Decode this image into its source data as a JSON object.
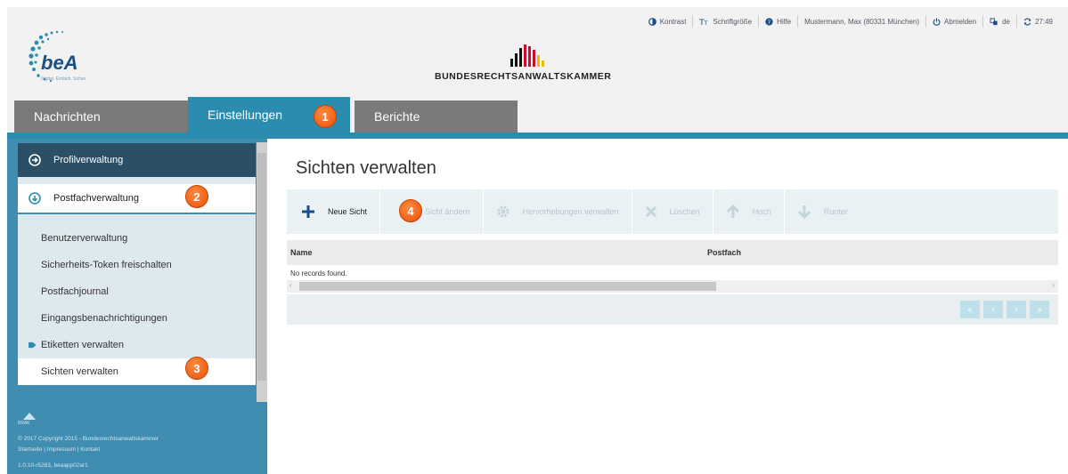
{
  "topbar": {
    "contrast": "Kontrast",
    "fontsize": "Schriftgröße",
    "help": "Hilfe",
    "user": "Mustermann, Max (80331 München)",
    "logout": "Abmelden",
    "lang": "de",
    "timer": "27:49"
  },
  "logo": {
    "name": "beA",
    "tagline": "Digital. Einfach. Sicher."
  },
  "brand": {
    "name": "BUNDESRECHTSANWALTSKAMMER"
  },
  "tabs": [
    {
      "label": "Nachrichten"
    },
    {
      "label": "Einstellungen"
    },
    {
      "label": "Berichte"
    }
  ],
  "sidebar": {
    "profil": "Profilverwaltung",
    "postfach": "Postfachverwaltung",
    "items": [
      {
        "label": "Benutzerverwaltung"
      },
      {
        "label": "Sicherheits-Token freischalten"
      },
      {
        "label": "Postfachjournal"
      },
      {
        "label": "Eingangsbenachrichtigungen"
      },
      {
        "label": "Etiketten verwalten"
      },
      {
        "label": "Sichten verwalten"
      }
    ],
    "footer": {
      "brak": "BRAK",
      "copyright": "© 2017 Copyright 2015 - Bundesrechtsanwaltskammer",
      "links": "Startseite | Impressum | Kontakt",
      "version": "1.0.10-r5283, beaapp02ar1"
    }
  },
  "main": {
    "title": "Sichten verwalten",
    "toolbar": {
      "new": "Neue Sicht",
      "edit": "Sicht ändern",
      "highlight": "Hervorhebungen verwalten",
      "delete": "Löschen",
      "up": "Hoch",
      "down": "Runter"
    },
    "columns": [
      "Name",
      "Postfach"
    ],
    "empty": "No records found."
  },
  "markers": [
    "1",
    "2",
    "3",
    "4"
  ],
  "colors": {
    "accent": "#2a8db0",
    "nav_dark": "#2b4f66",
    "marker": "#e8510c"
  }
}
